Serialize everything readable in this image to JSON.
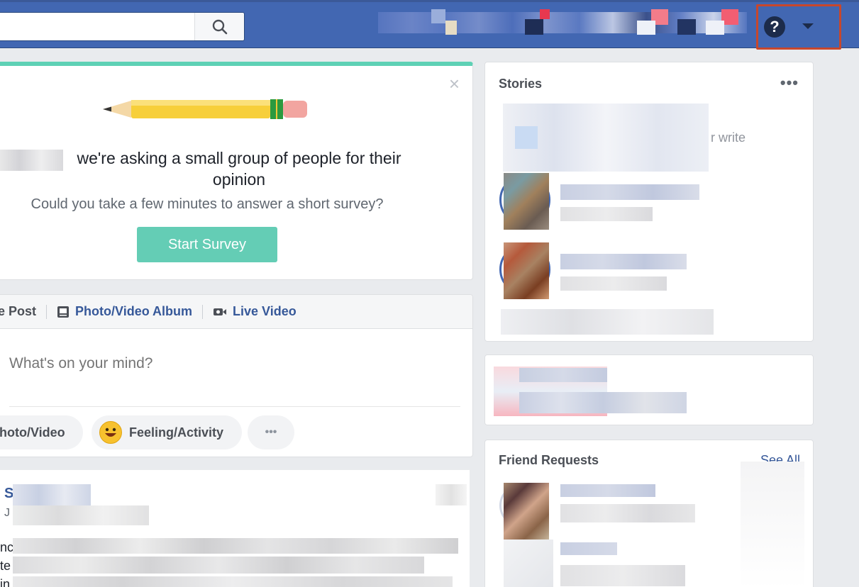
{
  "search": {
    "placeholder": "",
    "value": ""
  },
  "topbar": {
    "help_icon": "question-icon",
    "menu_icon": "caret-down-icon"
  },
  "survey": {
    "close_icon": "close-icon",
    "title": "we're asking a small group of people for their opinion",
    "subtitle": "Could you take a few minutes to answer a short survey?",
    "button": "Start Survey"
  },
  "composer": {
    "tabs": [
      {
        "label": "e Post",
        "icon": "pencil-icon"
      },
      {
        "label": "Photo/Video Album",
        "icon": "photo-album-icon"
      },
      {
        "label": "Live Video",
        "icon": "video-camera-icon"
      }
    ],
    "placeholder": "What's on your mind?",
    "actions": [
      {
        "label": "hoto/Video",
        "icon": "photo-icon"
      },
      {
        "label": "Feeling/Activity",
        "icon": "smiley-icon"
      },
      {
        "label": "•••",
        "icon": "more-icon"
      }
    ]
  },
  "feed": {
    "author_initial": "S",
    "date_initial": "J",
    "line_starts": [
      "nc",
      "te",
      "in"
    ]
  },
  "stories": {
    "title": "Stories",
    "more": "•••",
    "fragment": "r write"
  },
  "friend_requests": {
    "title": "Friend Requests",
    "see_all": "See All"
  },
  "colors": {
    "topbar": "#4267b2",
    "survey_accent": "#5ed1b5",
    "survey_button": "#64cdb5",
    "highlight": "#c8472c",
    "link": "#365899"
  }
}
